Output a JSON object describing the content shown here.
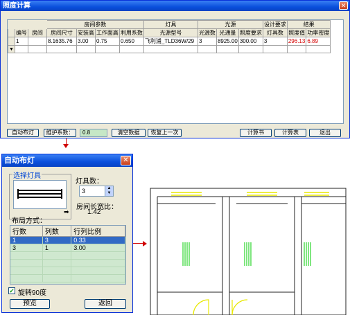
{
  "calc_window": {
    "title": "照度计算",
    "close_glyph": "✕",
    "groups": {
      "room_params": "房间参数",
      "lamp": "灯具",
      "light_source": "光源",
      "design_req": "设计要求",
      "result": "结果"
    },
    "columns": [
      "编号",
      "房间",
      "房间尺寸",
      "安装高",
      "工作面高",
      "利用系数",
      "光源型号",
      "光源数",
      "光通量",
      "照度要求",
      "灯具数",
      "照度值",
      "功率密度"
    ],
    "row": {
      "id": "1",
      "room": "",
      "size": "8.1635.76",
      "mount_h": "3.00",
      "work_h": "0.75",
      "util": "0.650",
      "model": "飞利浦_TLD36W/29",
      "src_count": "3",
      "flux": "8925.00",
      "illum_req": "300.00",
      "lamp_count": "3",
      "illum_val": "296.13",
      "power_density": "6.89"
    },
    "toolbar": {
      "auto_layout": "自动布灯",
      "maint_label": "维护系数：",
      "maint_value": "0.8",
      "clear": "清空数据",
      "restore": "恢复上一次",
      "calc_sheet": "计算书",
      "calc_table": "计算表",
      "exit": "退出"
    }
  },
  "auto_dialog": {
    "title": "自动布灯",
    "close_glyph": "✕",
    "select_lamp": "选择灯具",
    "lamp_count_label": "灯具数：",
    "lamp_count_value": "3",
    "aspect_label": "房间长宽比：",
    "aspect_value": "1.42",
    "layout_label": "布局方式：",
    "list_headers": [
      "行数",
      "列数",
      "行列比例"
    ],
    "list_rows": [
      {
        "rows": "1",
        "cols": "3",
        "ratio": "0.33"
      },
      {
        "rows": "3",
        "cols": "1",
        "ratio": "3.00"
      }
    ],
    "selected_row": 0,
    "rotate_label": "旋转90度",
    "rotate_checked": true,
    "preview_btn": "预览",
    "back_btn": "返回"
  },
  "colors": {
    "title_blue": "#0a4fdc",
    "result_red": "#d40000",
    "list_green": "#cfe8cf",
    "lamp_green": "#00cc00",
    "door_yellow": "#e8e800",
    "arrow_red": "#d00000"
  }
}
